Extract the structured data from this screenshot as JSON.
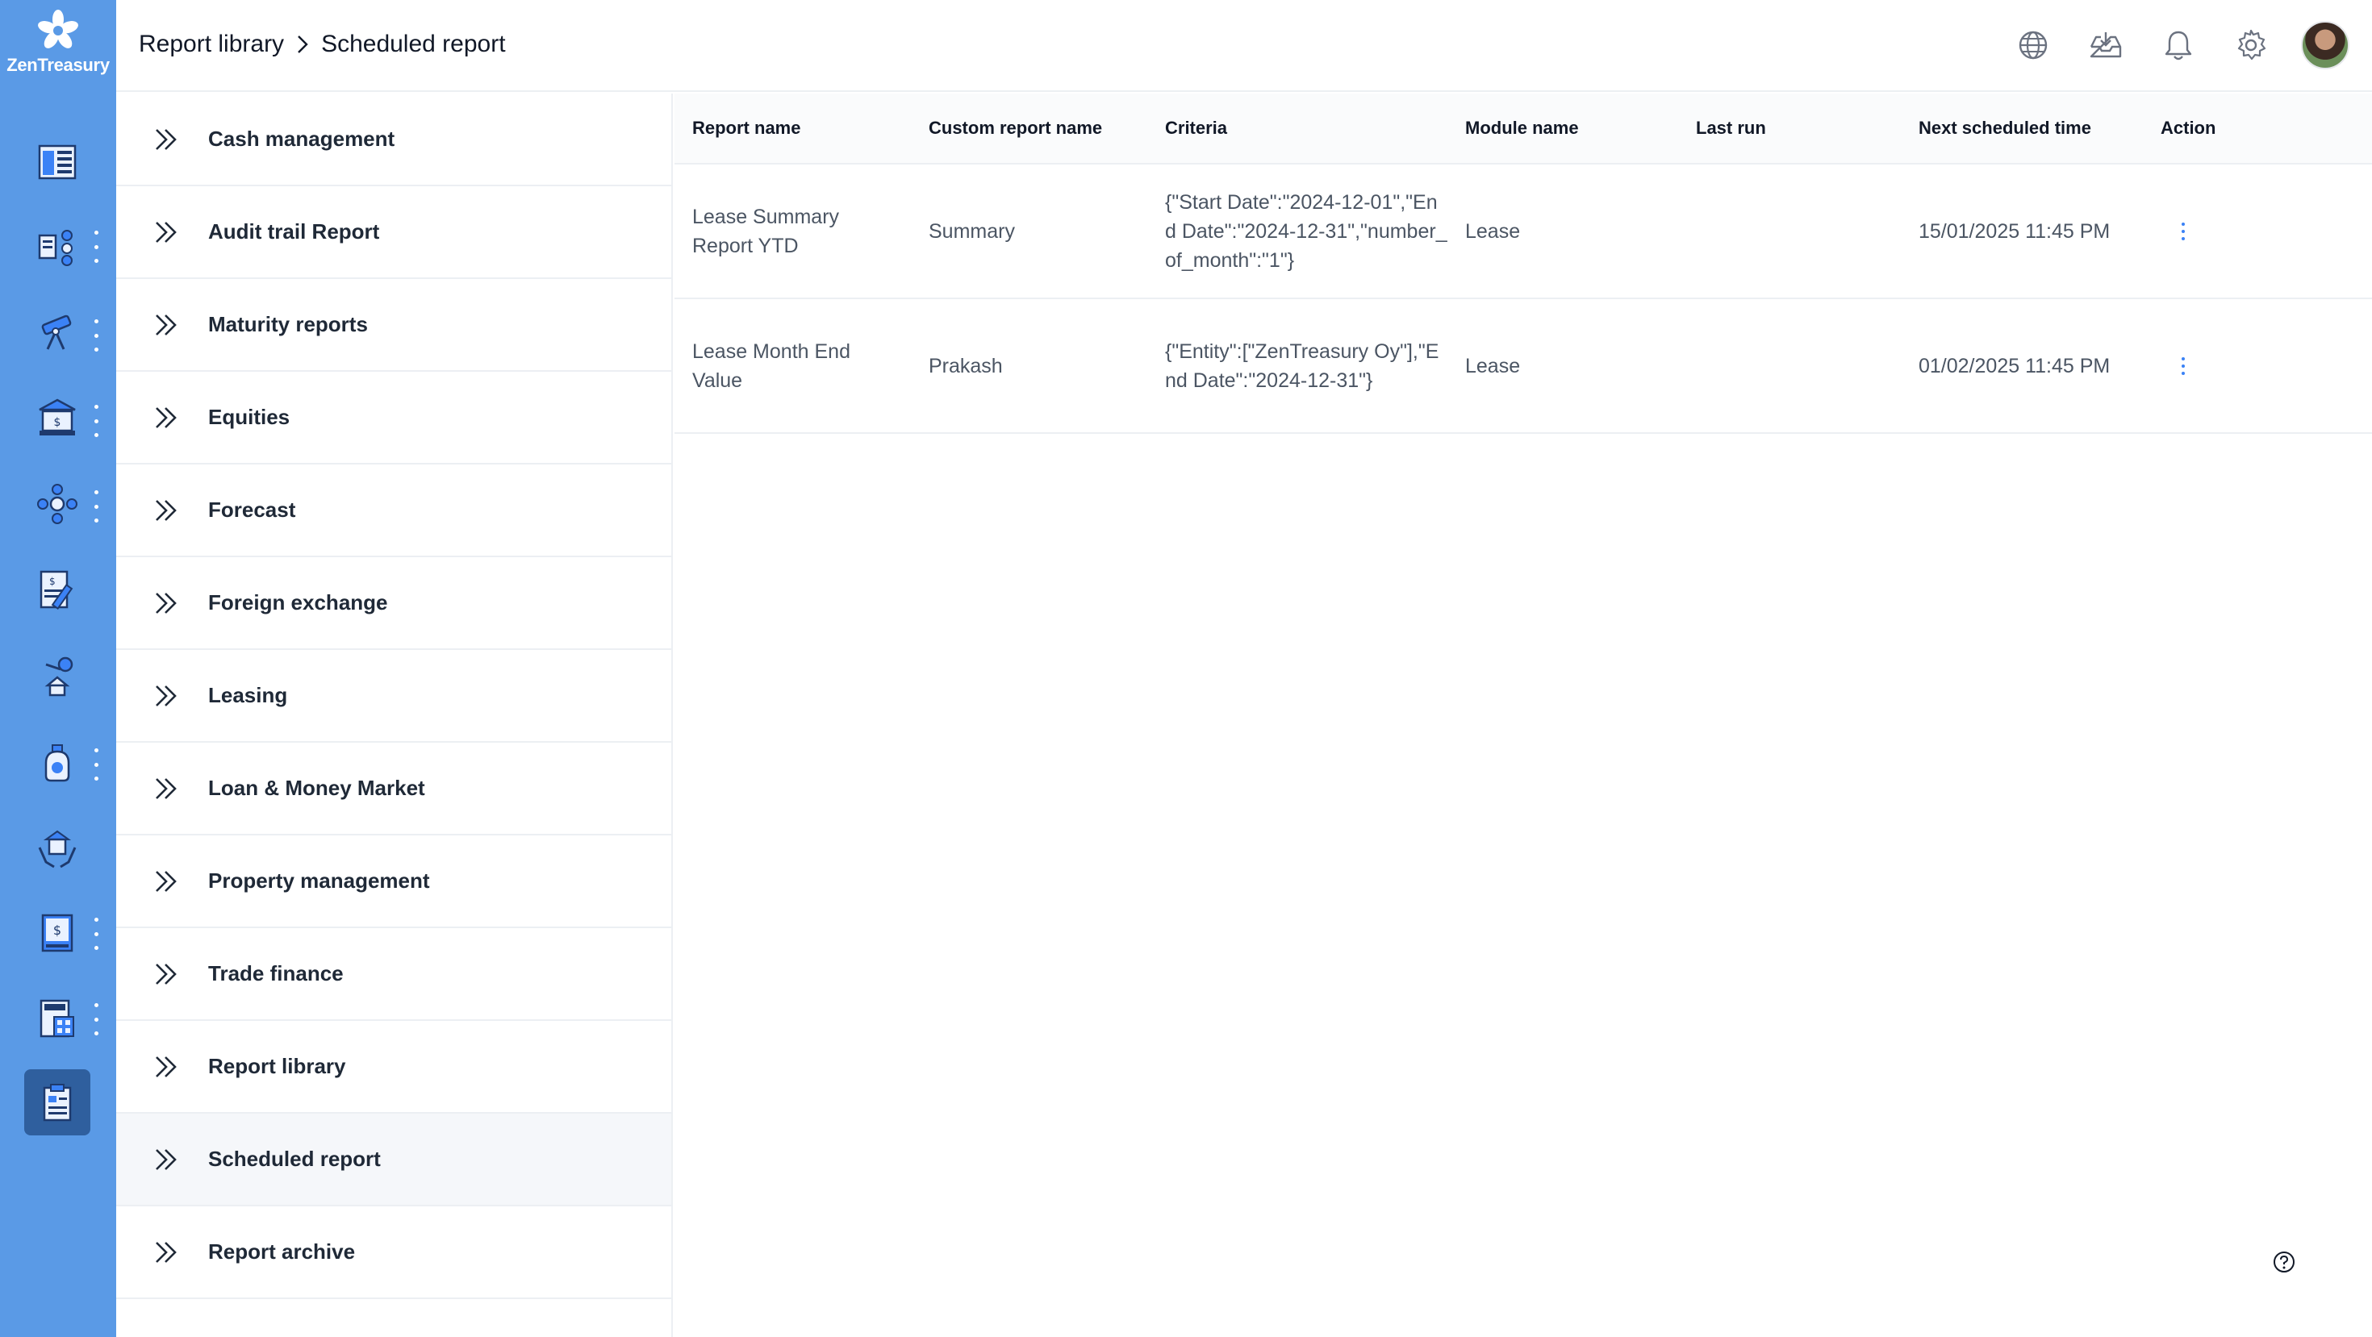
{
  "app": {
    "name": "ZenTreasury"
  },
  "breadcrumb": {
    "parent": "Report library",
    "current": "Scheduled report"
  },
  "rail": {
    "items": [
      {
        "icon": "dashboard-icon",
        "has_menu": false
      },
      {
        "icon": "cash-flow-icon",
        "has_menu": true
      },
      {
        "icon": "telescope-icon",
        "has_menu": true
      },
      {
        "icon": "bank-icon",
        "has_menu": true
      },
      {
        "icon": "network-icon",
        "has_menu": true
      },
      {
        "icon": "invoice-icon",
        "has_menu": false
      },
      {
        "icon": "property-key-icon",
        "has_menu": false
      },
      {
        "icon": "money-bag-icon",
        "has_menu": true
      },
      {
        "icon": "hands-building-icon",
        "has_menu": false
      },
      {
        "icon": "ledger-book-icon",
        "has_menu": true
      },
      {
        "icon": "calculator-icon",
        "has_menu": true
      },
      {
        "icon": "report-clipboard-icon",
        "has_menu": false,
        "active": true
      }
    ]
  },
  "menu": {
    "items": [
      {
        "label": "Cash management"
      },
      {
        "label": "Audit trail Report"
      },
      {
        "label": "Maturity reports"
      },
      {
        "label": "Equities"
      },
      {
        "label": "Forecast"
      },
      {
        "label": "Foreign exchange"
      },
      {
        "label": "Leasing"
      },
      {
        "label": "Loan & Money Market"
      },
      {
        "label": "Property management"
      },
      {
        "label": "Trade finance"
      },
      {
        "label": "Report library"
      },
      {
        "label": "Scheduled report",
        "active": true
      },
      {
        "label": "Report archive"
      }
    ]
  },
  "table": {
    "headers": {
      "report_name": "Report name",
      "custom_report_name": "Custom report name",
      "criteria": "Criteria",
      "module_name": "Module name",
      "last_run": "Last run",
      "next_scheduled": "Next scheduled time",
      "action": "Action"
    },
    "rows": [
      {
        "report_name": "Lease Summary Report YTD",
        "custom_report_name": "Summary",
        "criteria": "{\"Start Date\":\"2024-12-01\",\"End Date\":\"2024-12-31\",\"number_of_month\":\"1\"}",
        "module_name": "Lease",
        "last_run": "",
        "next_scheduled": "15/01/2025 11:45 PM"
      },
      {
        "report_name": "Lease Month End Value",
        "custom_report_name": "Prakash",
        "criteria": "{\"Entity\":[\"ZenTreasury Oy\"],\"End Date\":\"2024-12-31\"}",
        "module_name": "Lease",
        "last_run": "",
        "next_scheduled": "01/02/2025 11:45 PM"
      }
    ]
  },
  "colors": {
    "rail": "#5a9ae6",
    "rail_active": "#2f5f9e",
    "accent": "#3b82f6"
  }
}
